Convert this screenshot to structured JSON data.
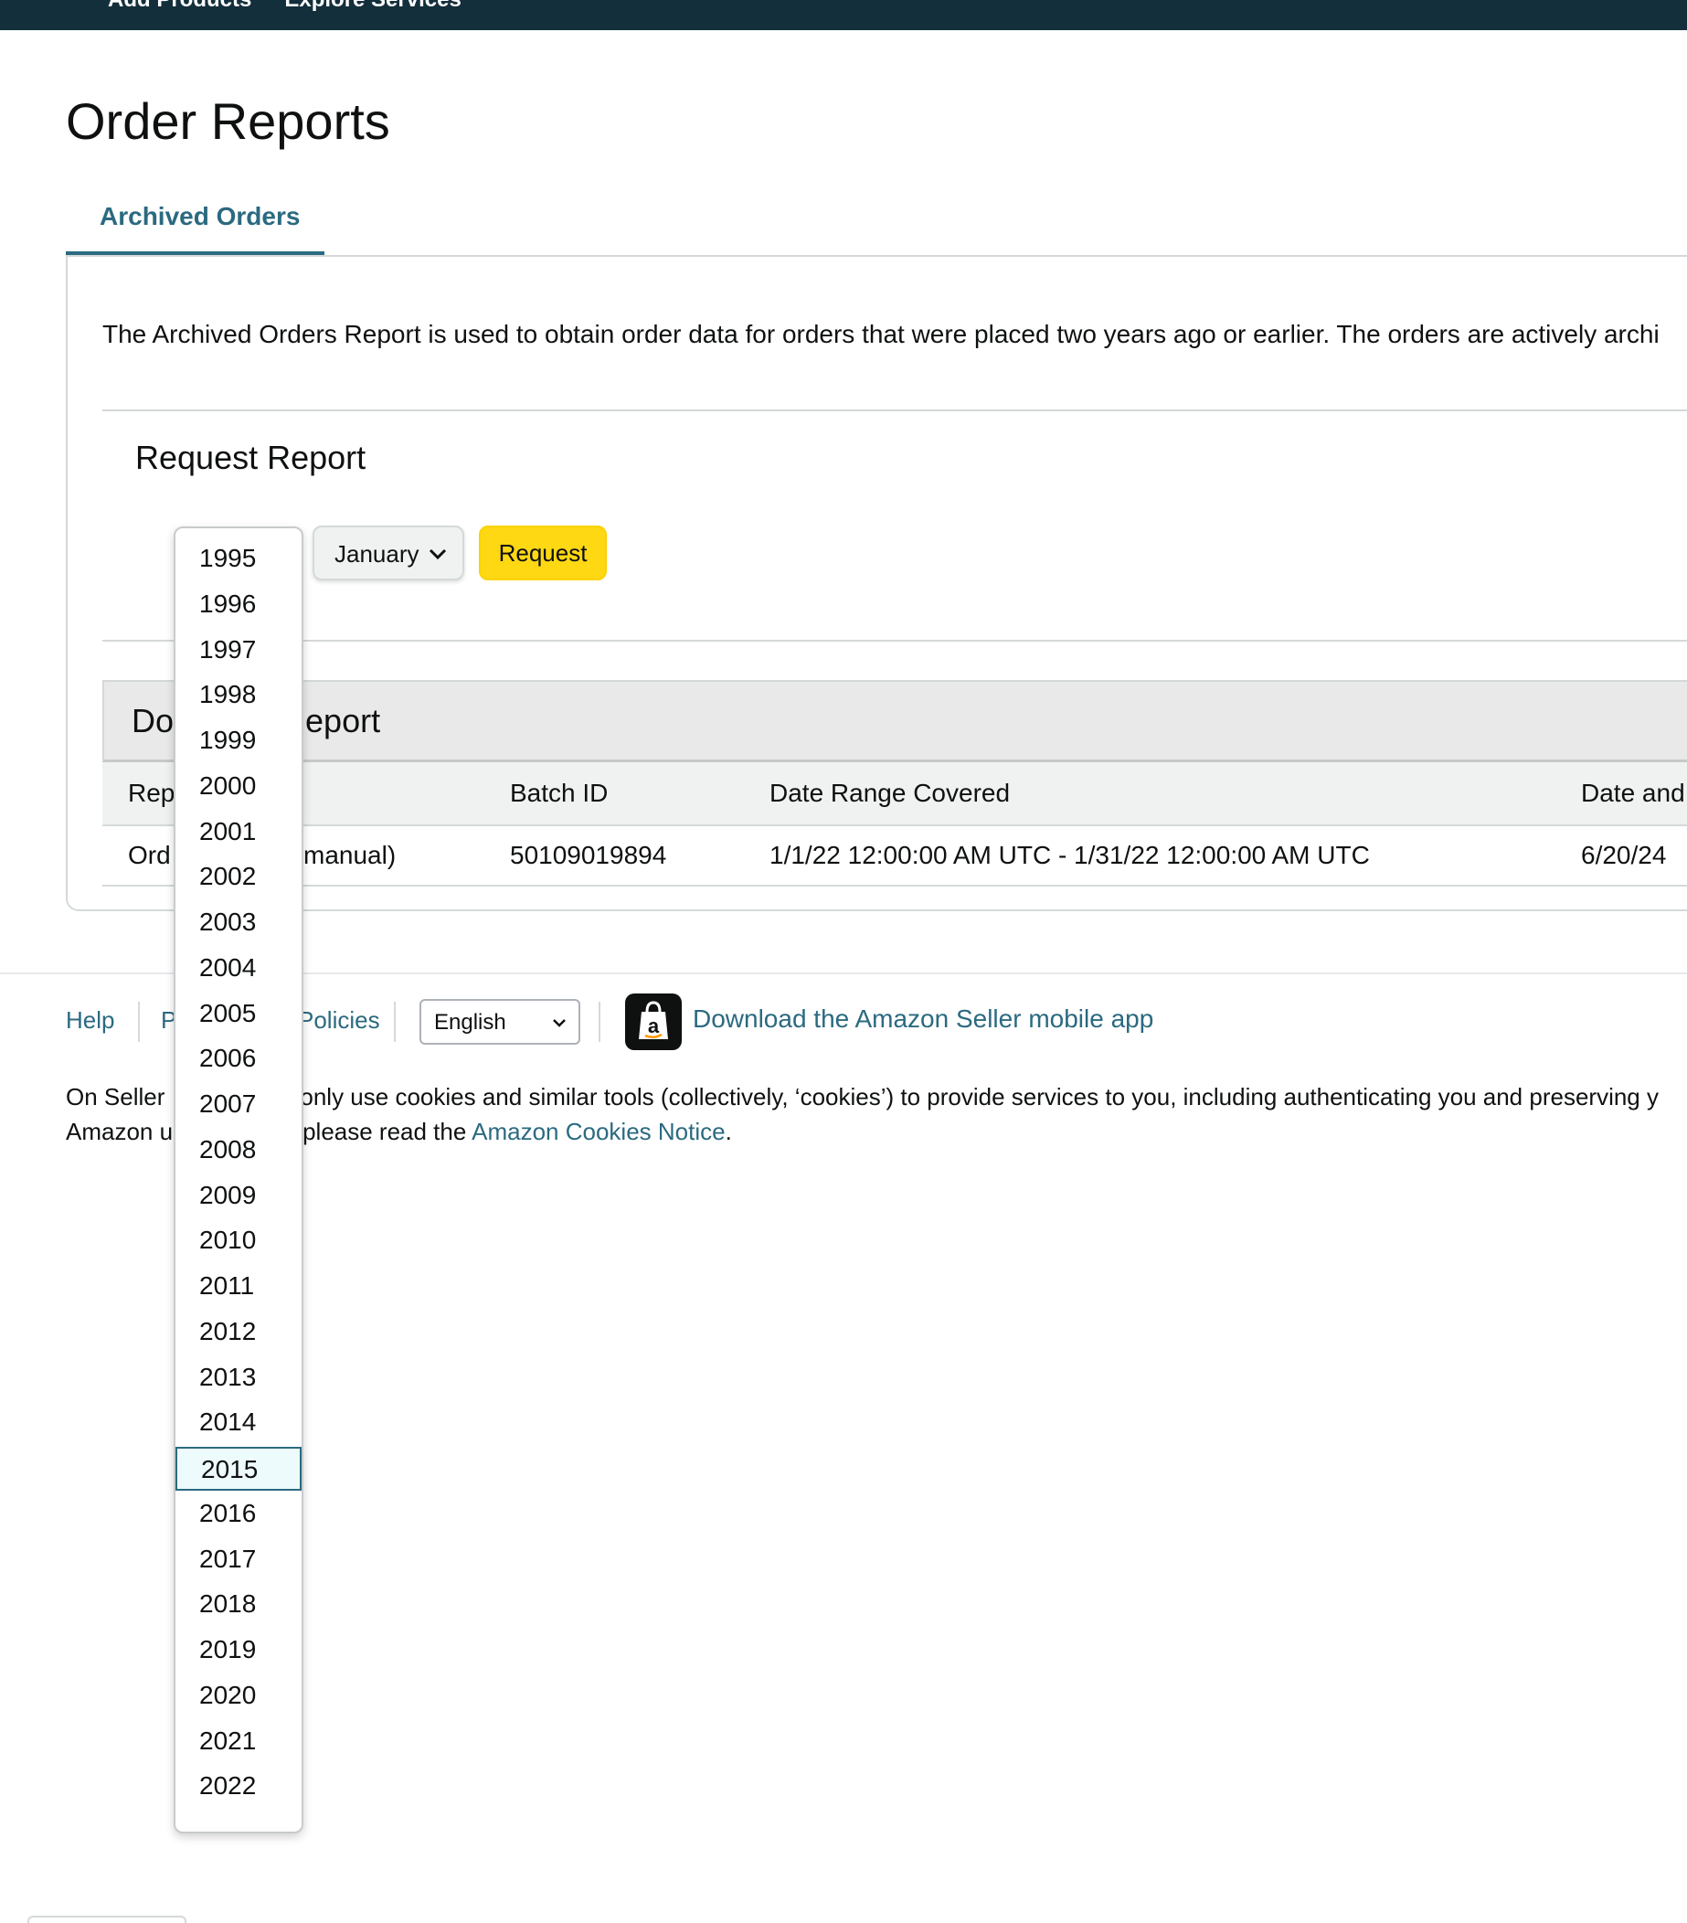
{
  "topnav": {
    "items": [
      "Add Products",
      "Explore Services"
    ]
  },
  "page": {
    "title": "Order Reports",
    "tab": "Archived Orders",
    "intro": "The Archived Orders Report is used to obtain order data for orders that were placed two years ago or earlier. The orders are actively archi"
  },
  "request": {
    "title": "Request Report",
    "month": "January",
    "button": "Request"
  },
  "download": {
    "title_left": "Do",
    "title_right": "Report",
    "headers": [
      "Rep",
      "Batch ID",
      "Date Range Covered",
      "Date and"
    ],
    "row": [
      "Ord",
      "manual)",
      "50109019894",
      "1/1/22 12:00:00 AM UTC - 1/31/22 12:00:00 AM UTC",
      "6/20/24"
    ]
  },
  "year_dropdown": {
    "options": [
      "1995",
      "1996",
      "1997",
      "1998",
      "1999",
      "2000",
      "2001",
      "2002",
      "2003",
      "2004",
      "2005",
      "2006",
      "2007",
      "2008",
      "2009",
      "2010",
      "2011",
      "2012",
      "2013",
      "2014",
      "2015",
      "2016",
      "2017",
      "2018",
      "2019",
      "2020",
      "2021",
      "2022"
    ],
    "highlighted": "2015"
  },
  "footer": {
    "help": "Help",
    "p_link": "P",
    "policies": "Policies",
    "language": "English",
    "app_link": "Download the Amazon Seller mobile app",
    "cookie_line1": "On Seller",
    "cookie_line1_right": "only use cookies and similar tools (collectively, ‘cookies’) to provide services to you, including authenticating you and preserving y",
    "cookie_line2": "Amazon u",
    "cookie_line2_right": "please read the",
    "cookie_link": "Amazon Cookies Notice",
    "cookie_period": "."
  },
  "colors": {
    "header_bg": "#132f3b",
    "link": "#2b6a80",
    "request_button": "#ffd814",
    "selected_option_bg": "#eefbfc"
  },
  "icons": [
    "chevron-down-icon",
    "amazon-app-icon"
  ]
}
